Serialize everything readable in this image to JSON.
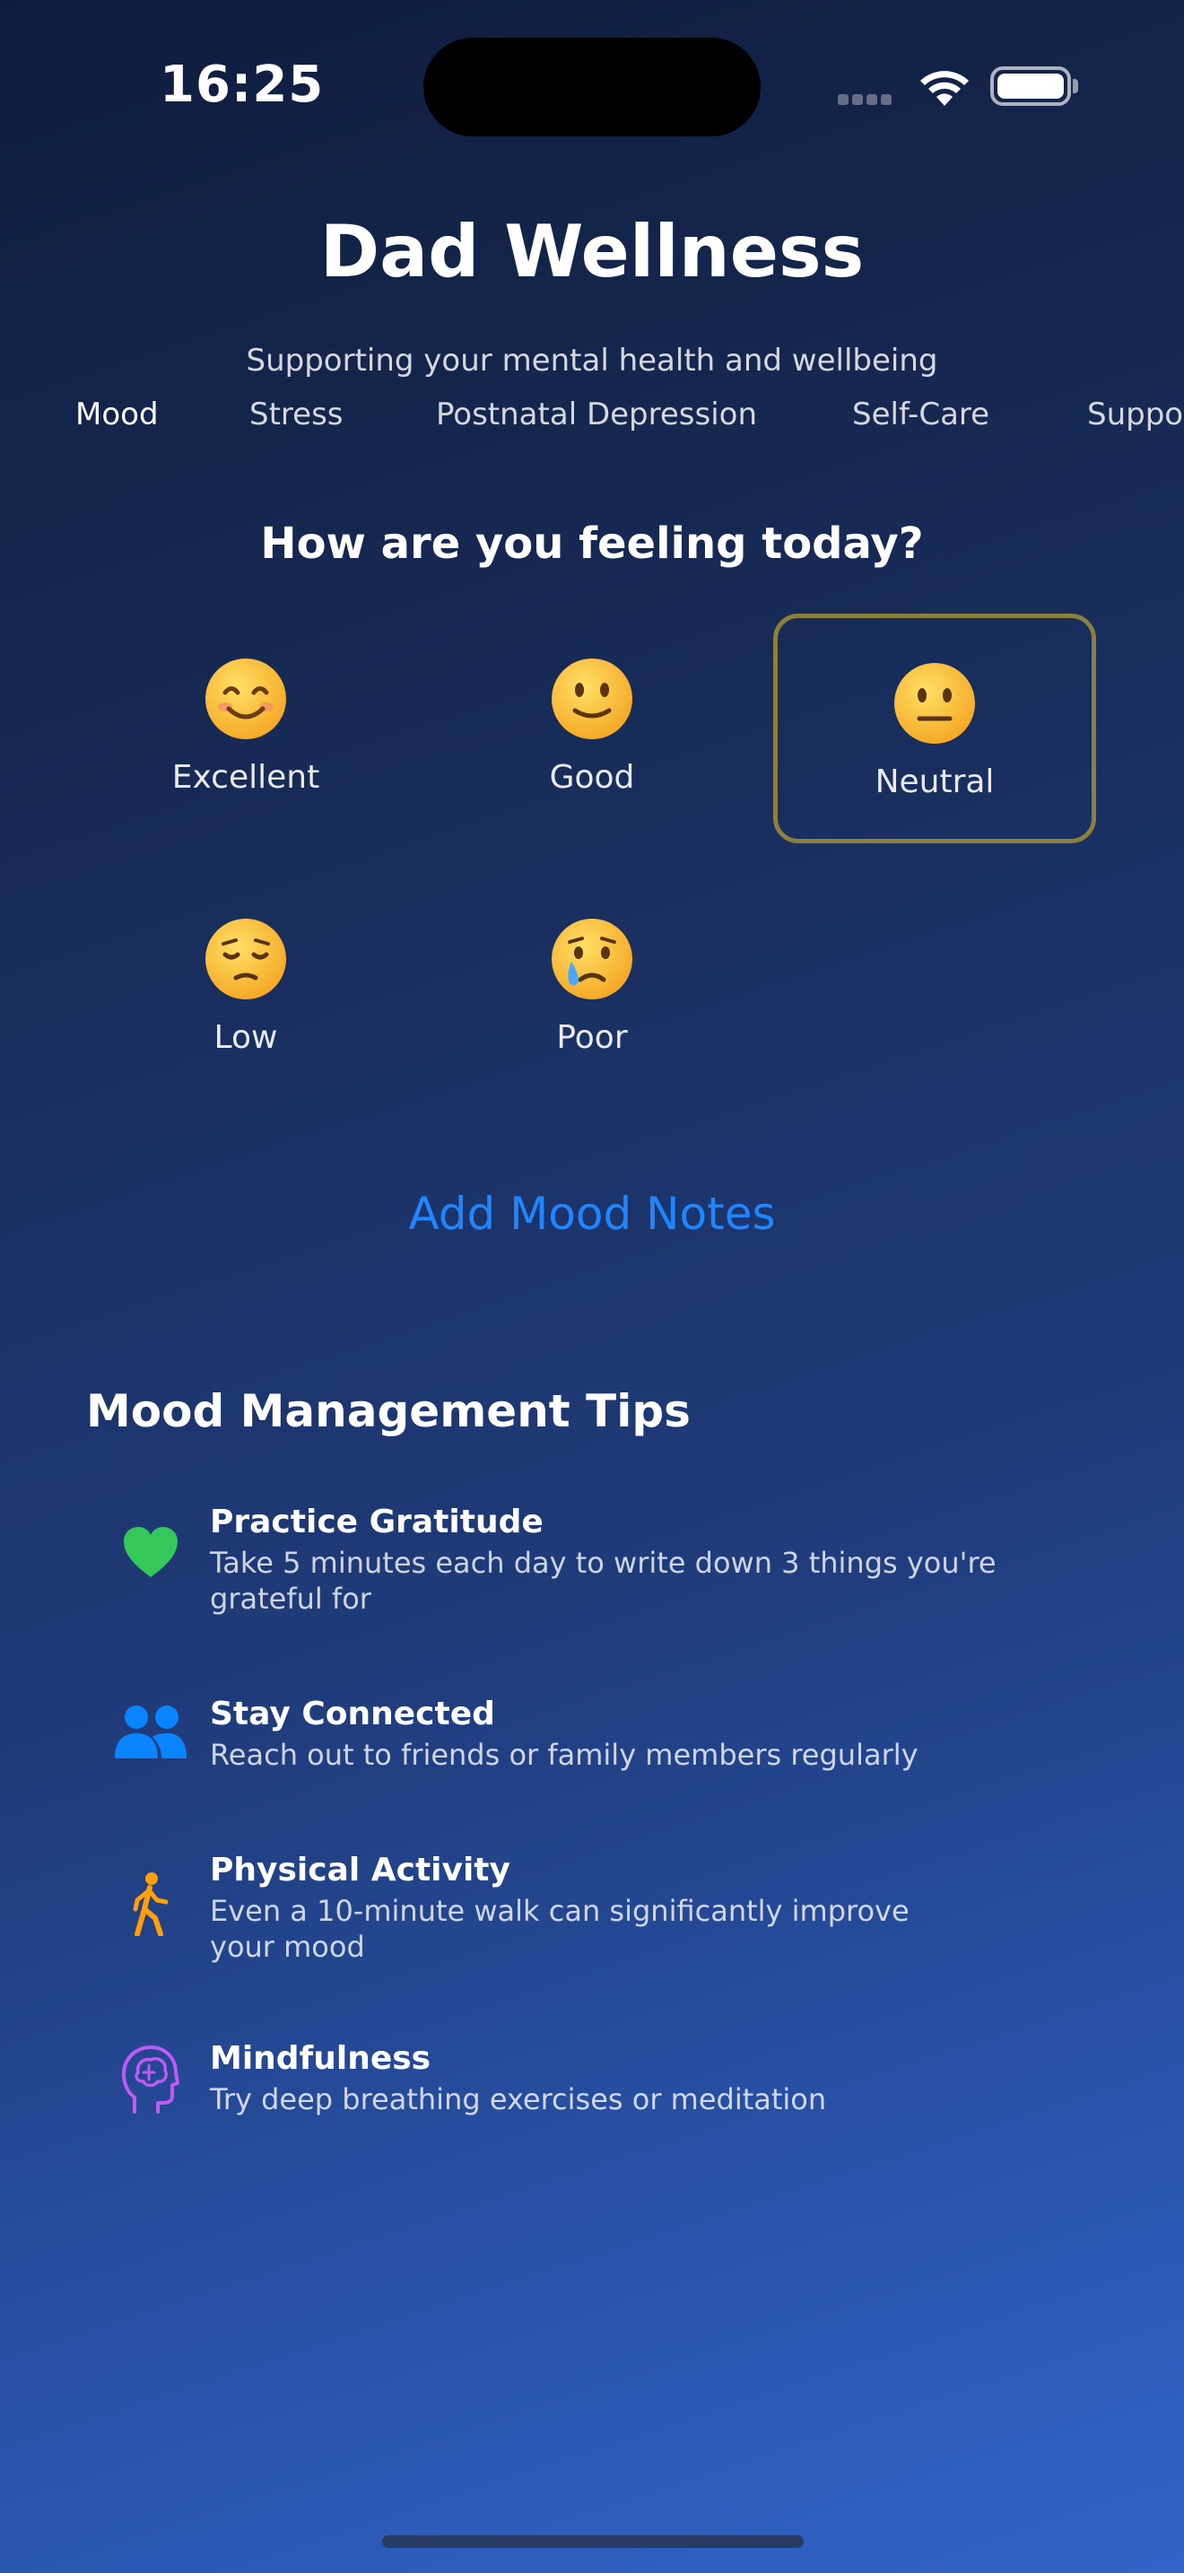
{
  "status_bar": {
    "time": "16:25"
  },
  "header": {
    "title": "Dad Wellness",
    "subtitle": "Supporting your mental health and wellbeing"
  },
  "tabs": [
    {
      "label": "Mood",
      "active": true
    },
    {
      "label": "Stress"
    },
    {
      "label": "Postnatal Depression"
    },
    {
      "label": "Self-Care"
    },
    {
      "label": "Suppo"
    }
  ],
  "mood_section": {
    "question": "How are you feeling today?",
    "options": [
      {
        "label": "Excellent",
        "icon": "smiling-face-icon"
      },
      {
        "label": "Good",
        "icon": "slightly-smiling-face-icon"
      },
      {
        "label": "Neutral",
        "icon": "neutral-face-icon",
        "selected": true
      },
      {
        "label": "Low",
        "icon": "pensive-face-icon"
      },
      {
        "label": "Poor",
        "icon": "crying-face-icon"
      }
    ],
    "add_notes_label": "Add Mood Notes"
  },
  "tips": {
    "title": "Mood Management Tips",
    "items": [
      {
        "title": "Practice Gratitude",
        "description_line1": "Take 5 minutes each day to write down 3 things you're",
        "description_line2": "grateful for",
        "icon": "heart-icon",
        "color": "#34c759"
      },
      {
        "title": "Stay Connected",
        "description_line1": "Reach out to friends or family members regularly",
        "icon": "people-icon",
        "color": "#0a84ff"
      },
      {
        "title": "Physical Activity",
        "description_line1": "Even a 10-minute walk can significantly improve",
        "description_line2": "your mood",
        "icon": "walking-figure-icon",
        "color": "#ff9f0a"
      },
      {
        "title": "Mindfulness",
        "description_line1": "Try deep breathing exercises or meditation",
        "icon": "brain-head-icon",
        "color": "#bf5af2"
      }
    ]
  },
  "colors": {
    "accent": "#1f86ff",
    "selected_border": "#8a7f3c",
    "background_top": "#0f1d3d",
    "background_bottom": "#3164c8"
  }
}
